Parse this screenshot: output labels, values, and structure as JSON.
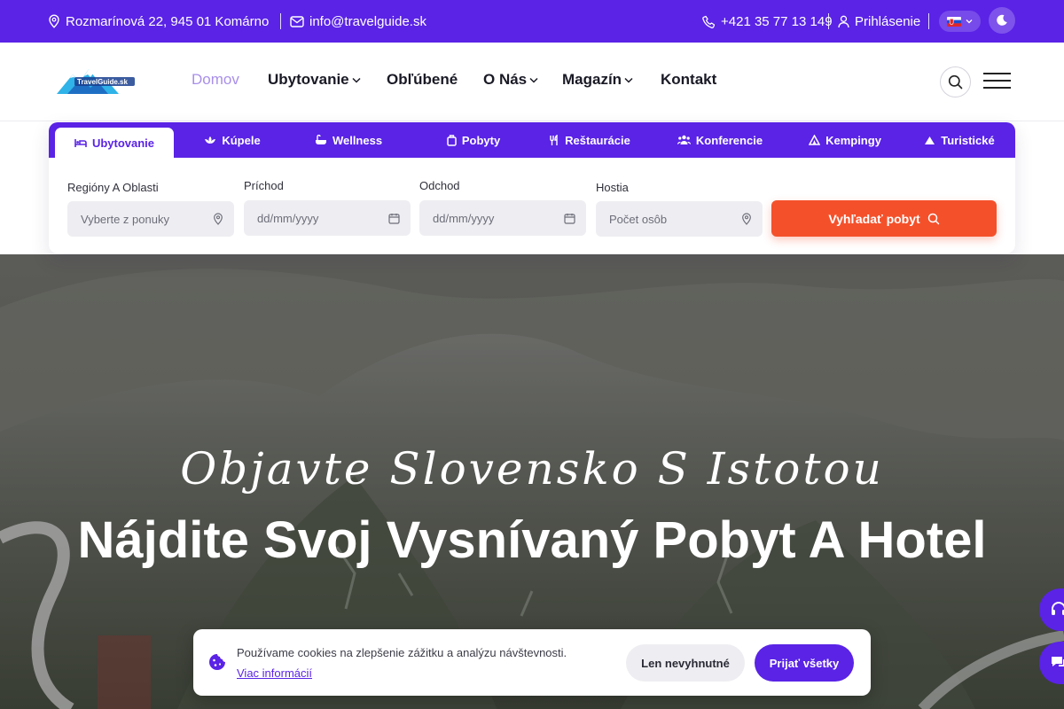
{
  "topbar": {
    "address": "Rozmarínová 22, 945 01 Komárno",
    "email": "info@travelguide.sk",
    "phone": "+421 35 77 13 149",
    "login": "Prihlásenie",
    "bg_color": "#5a23e6",
    "icons": [
      "location-pin-icon",
      "envelope-icon",
      "phone-icon",
      "user-icon",
      "slovak-flag-icon",
      "chevron-down-icon",
      "moon-icon"
    ]
  },
  "header": {
    "logo_text": "TravelGuide.sk",
    "nav": [
      {
        "label": "Domov",
        "active": true,
        "dropdown": false
      },
      {
        "label": "Ubytovanie",
        "active": false,
        "dropdown": true
      },
      {
        "label": "Obľúbené",
        "active": false,
        "dropdown": false
      },
      {
        "label": "O Nás",
        "active": false,
        "dropdown": true
      },
      {
        "label": "Magazín",
        "active": false,
        "dropdown": true
      },
      {
        "label": "Kontakt",
        "active": false,
        "dropdown": false
      }
    ],
    "icons": [
      "search-icon",
      "hamburger-menu-icon"
    ]
  },
  "search": {
    "tabs": [
      {
        "label": "Ubytovanie",
        "icon": "bed-icon",
        "active": true
      },
      {
        "label": "Kúpele",
        "icon": "lotus-icon",
        "active": false
      },
      {
        "label": "Wellness",
        "icon": "bathtub-icon",
        "active": false
      },
      {
        "label": "Pobyty",
        "icon": "suitcase-icon",
        "active": false
      },
      {
        "label": "Reštaurácie",
        "icon": "cutlery-icon",
        "active": false
      },
      {
        "label": "Konferencie",
        "icon": "people-icon",
        "active": false
      },
      {
        "label": "Kempingy",
        "icon": "tent-icon",
        "active": false
      },
      {
        "label": "Turistické",
        "icon": "mountain-icon",
        "active": false
      }
    ],
    "fields": [
      {
        "label": "Regióny A Oblasti",
        "placeholder": "Vyberte z ponuky",
        "icon": "location-pin-icon"
      },
      {
        "label": "Príchod",
        "placeholder": "dd/mm/yyyy",
        "icon": "calendar-icon"
      },
      {
        "label": "Odchod",
        "placeholder": "dd/mm/yyyy",
        "icon": "calendar-icon"
      },
      {
        "label": "Hostia",
        "placeholder": "Počet osôb",
        "icon": "location-pin-icon"
      }
    ],
    "button_label": "Vyhľadať pobyt",
    "button_color": "#f4512b"
  },
  "hero": {
    "script_title": "Objavte Slovensko S Istotou",
    "title": "Nájdite Svoj Vysnívaný Pobyt A Hotel"
  },
  "cookie": {
    "text": "Používame cookies na zlepšenie zážitku a analýzu návštevnosti.",
    "link": "Viac informácií",
    "reject_label": "Len nevyhnutné",
    "accept_label": "Prijať všetky"
  }
}
